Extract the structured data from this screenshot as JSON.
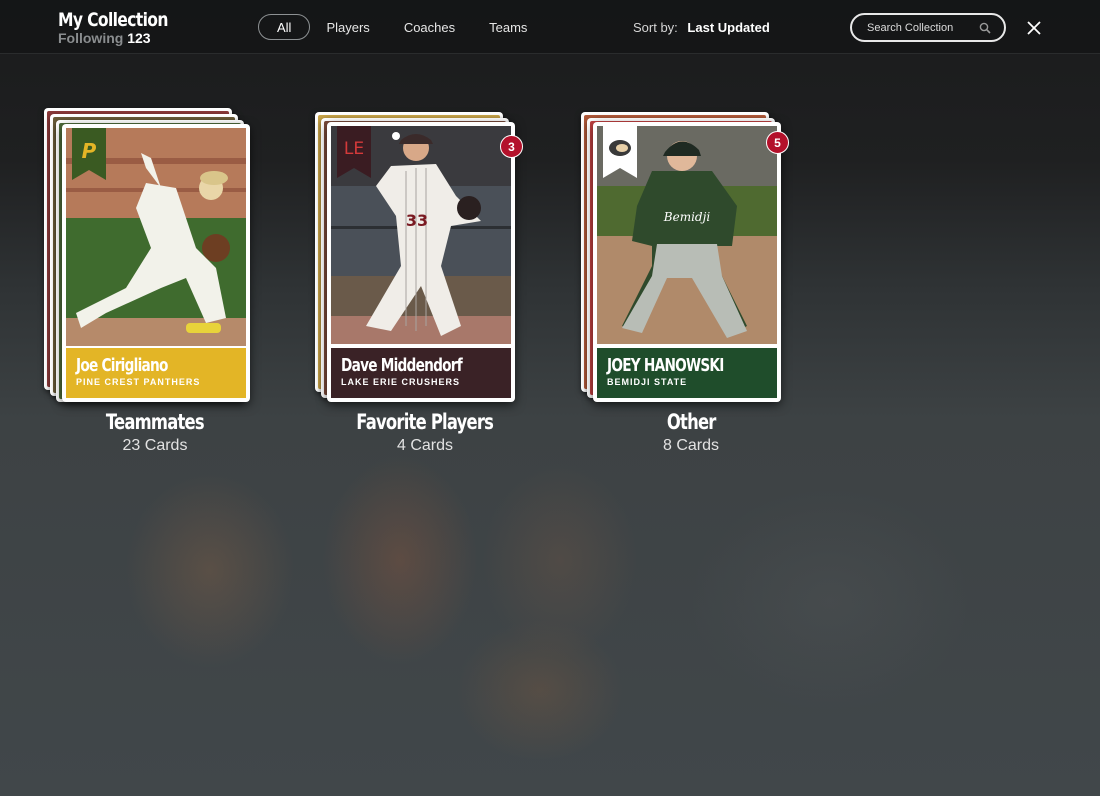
{
  "header": {
    "title": "My Collection",
    "following_label": "Following",
    "following_count": "123"
  },
  "filters": [
    {
      "label": "All",
      "active": true
    },
    {
      "label": "Players",
      "active": false
    },
    {
      "label": "Coaches",
      "active": false
    },
    {
      "label": "Teams",
      "active": false
    }
  ],
  "sort": {
    "label": "Sort by:",
    "value": "Last Updated"
  },
  "search": {
    "placeholder": "Search Collection"
  },
  "groups": [
    {
      "title": "Teammates",
      "count": "23 Cards",
      "badge": "",
      "top_card": {
        "player": "Joe Cirigliano",
        "team": "PINE CREST PANTHERS",
        "team_color": "#e3b526",
        "logo_letter": "P",
        "logo_color": "#3a5a22"
      }
    },
    {
      "title": "Favorite Players",
      "count": "4 Cards",
      "badge": "3",
      "top_card": {
        "player": "Dave Middendorf",
        "team": "LAKE ERIE CRUSHERS",
        "team_color": "#3a2226",
        "logo_letter": "LE",
        "logo_color": "#3a1c22"
      }
    },
    {
      "title": "Other",
      "count": "8 Cards",
      "badge": "5",
      "top_card": {
        "player": "JOEY HANOWSKI",
        "team": "BEMIDJI STATE",
        "team_color": "#1f4d2b",
        "logo_letter": "",
        "logo_color": "#ffffff"
      }
    }
  ],
  "colors": {
    "accent_badge": "#b3112b"
  },
  "icons": {
    "search": "search-icon",
    "close": "close-icon"
  }
}
